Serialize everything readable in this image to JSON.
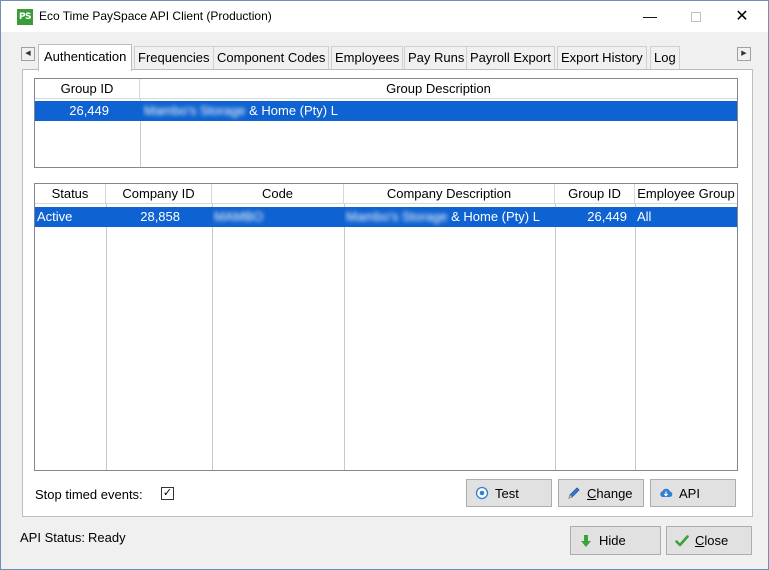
{
  "window": {
    "title": "Eco Time PaySpace API Client (Production)",
    "icon_text": "PS",
    "minimize_glyph": "—",
    "close_glyph": "✕"
  },
  "tabs": [
    {
      "label": "Authentication",
      "active": true
    },
    {
      "label": "Frequencies"
    },
    {
      "label": "Component Codes"
    },
    {
      "label": "Employees"
    },
    {
      "label": "Pay Runs"
    },
    {
      "label": "Payroll Export"
    },
    {
      "label": "Export History"
    },
    {
      "label": "Log"
    }
  ],
  "groups_grid": {
    "headers": {
      "group_id": "Group ID",
      "group_description": "Group Description"
    },
    "rows": [
      {
        "group_id": "26,449",
        "description_blurred": "Mambo's Storage",
        "description_visible": " & Home (Pty) L"
      }
    ]
  },
  "companies_grid": {
    "headers": {
      "status": "Status",
      "company_id": "Company ID",
      "code": "Code",
      "company_description": "Company Description",
      "group_id": "Group ID",
      "employee_group": "Employee Group"
    },
    "rows": [
      {
        "status": "Active",
        "company_id": "28,858",
        "code_blurred": "MAMBO",
        "description_blurred": "Mambo's Storage",
        "description_visible": " & Home (Pty) L",
        "group_id": "26,449",
        "employee_group": "All"
      }
    ]
  },
  "stop_timed_events": {
    "label": "Stop timed events:",
    "checked": true,
    "check_glyph": "✓"
  },
  "buttons": {
    "test": {
      "label": "Test",
      "icon": "radio-target-icon"
    },
    "change_prefix": "C",
    "change_rest": "hange",
    "change_icon": "pencil-icon",
    "api": {
      "label": "API",
      "icon": "cloud-download-icon"
    },
    "hide": {
      "label": "Hide",
      "icon": "arrow-down-icon"
    },
    "close_prefix": "C",
    "close_rest": "lose",
    "close_icon": "checkmark-icon"
  },
  "status_bar": {
    "label": "API Status:",
    "value": "Ready"
  },
  "colors": {
    "selection": "#0f62d1",
    "app_icon": "#3a9d3a",
    "hide_arrow": "#3aa33a",
    "close_check": "#3aa33a",
    "api_cloud": "#2f7fd3"
  }
}
